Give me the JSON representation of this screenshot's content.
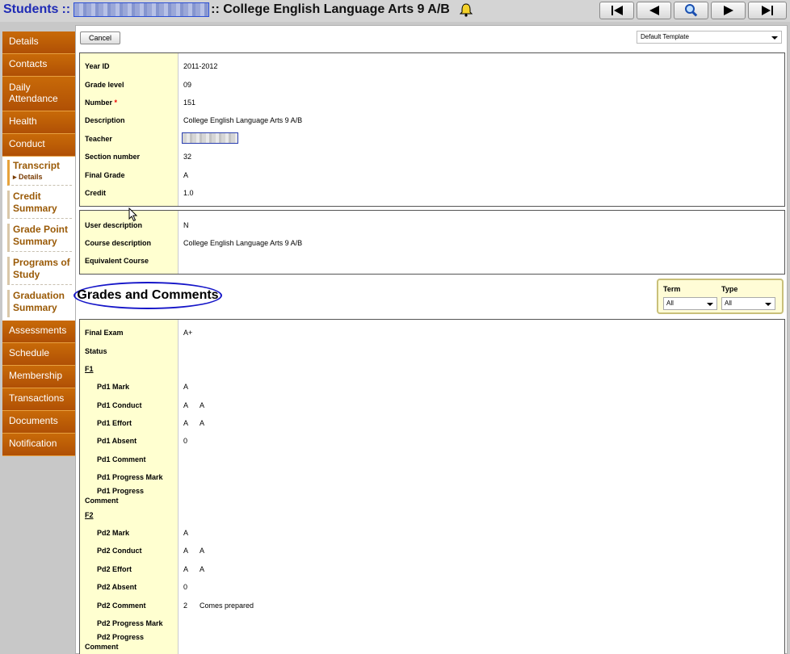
{
  "header": {
    "students_link": "Students",
    "separator": "::",
    "course_title": ":: College English Language Arts 9 A/B",
    "nav_buttons": [
      "first-record-icon",
      "previous-record-icon",
      "search-icon",
      "next-record-icon",
      "last-record-icon"
    ]
  },
  "sidebar": {
    "tabs_top": [
      "Details",
      "Contacts",
      "Daily Attendance",
      "Health",
      "Conduct"
    ],
    "subtabs": [
      {
        "label": "Transcript",
        "child": "▸ Details",
        "active": true
      },
      {
        "label": "Credit Summary"
      },
      {
        "label": "Grade Point Summary"
      },
      {
        "label": "Programs of Study"
      },
      {
        "label": "Graduation Summary"
      }
    ],
    "tabs_bottom": [
      "Assessments",
      "Schedule",
      "Membership",
      "Transactions",
      "Documents",
      "Notification"
    ]
  },
  "toolbar": {
    "cancel_label": "Cancel",
    "template_value": "Default Template"
  },
  "details": {
    "rows": [
      {
        "label": "Year ID",
        "value": "2011-2012"
      },
      {
        "label": "Grade level",
        "value": "09"
      },
      {
        "label": "Number",
        "required": "*",
        "value": "151"
      },
      {
        "label": "Description",
        "value": "College English Language Arts 9 A/B"
      },
      {
        "label": "Teacher",
        "value": ""
      },
      {
        "label": "Section number",
        "value": "32"
      },
      {
        "label": "Final Grade",
        "value": "A"
      },
      {
        "label": "Credit",
        "value": "1.0"
      }
    ]
  },
  "course_info": {
    "rows": [
      {
        "label": "User description",
        "value": "N"
      },
      {
        "label": "Course description",
        "value": "College English Language Arts 9 A/B"
      },
      {
        "label": "Equivalent Course",
        "value": ""
      }
    ]
  },
  "grades": {
    "title": "Grades and Comments",
    "filter": {
      "term_label": "Term",
      "term_value": "All",
      "type_label": "Type",
      "type_value": "All"
    },
    "final_exam_label": "Final Exam",
    "final_exam_value": "A+",
    "status_label": "Status",
    "f1": "F1",
    "f2": "F2",
    "pd1": {
      "mark_label": "Pd1 Mark",
      "mark": "A",
      "conduct_label": "Pd1 Conduct",
      "conduct": "A",
      "conduct2": "A",
      "effort_label": "Pd1 Effort",
      "effort": "A",
      "effort2": "A",
      "absent_label": "Pd1 Absent",
      "absent": "0",
      "comment_label": "Pd1 Comment",
      "progress_mark_label": "Pd1 Progress Mark",
      "progress_comment_label_1": "Pd1 Progress",
      "progress_comment_label_2": "Comment"
    },
    "pd2": {
      "mark_label": "Pd2 Mark",
      "mark": "A",
      "conduct_label": "Pd2 Conduct",
      "conduct": "A",
      "conduct2": "A",
      "effort_label": "Pd2 Effort",
      "effort": "A",
      "effort2": "A",
      "absent_label": "Pd2 Absent",
      "absent": "0",
      "comment_label": "Pd2 Comment",
      "comment": "2",
      "comment2": "Comes prepared",
      "progress_mark_label": "Pd2 Progress Mark",
      "progress_comment_label_1": "Pd2 Progress",
      "progress_comment_label_2": "Comment"
    }
  },
  "colors": {
    "tab_orange": "#bb5a05",
    "label_bg": "#ffffd0",
    "link_blue": "#1f2bb5"
  }
}
